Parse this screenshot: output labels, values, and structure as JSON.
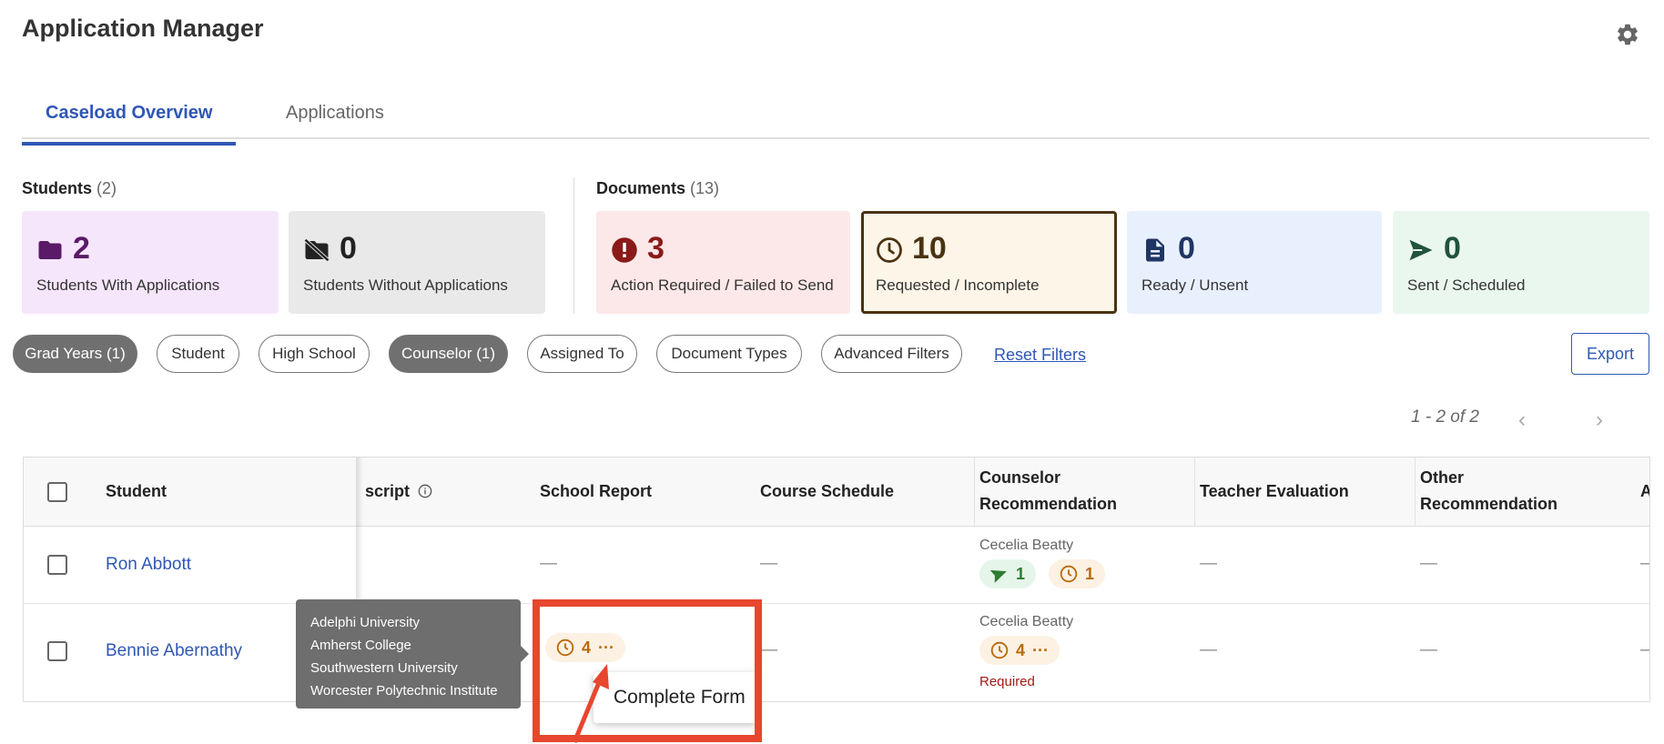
{
  "app": {
    "title": "Application Manager"
  },
  "tabs": [
    {
      "label": "Caseload Overview"
    },
    {
      "label": "Applications"
    }
  ],
  "students": {
    "label": "Students",
    "count": "(2)"
  },
  "documents": {
    "label": "Documents",
    "count": "(13)"
  },
  "cards": [
    {
      "value": "2",
      "label": "Students With Applications",
      "icon": "folder-icon",
      "bg": "#f6e6fb",
      "color": "#5a1a68"
    },
    {
      "value": "0",
      "label": "Students Without Applications",
      "icon": "folder-off-icon",
      "bg": "#e9e9e9",
      "color": "#222222"
    },
    {
      "value": "3",
      "label": "Action Required / Failed to Send",
      "icon": "alert-icon",
      "bg": "#fce8e8",
      "color": "#8a1a1a"
    },
    {
      "value": "10",
      "label": "Requested / Incomplete",
      "icon": "clock-icon",
      "bg": "#fdf5e8",
      "color": "#4a3312"
    },
    {
      "value": "0",
      "label": "Ready / Unsent",
      "icon": "document-icon",
      "bg": "#e9f0fd",
      "color": "#1f3564"
    },
    {
      "value": "0",
      "label": "Sent / Scheduled",
      "icon": "send-icon",
      "bg": "#eaf7ef",
      "color": "#21533b"
    }
  ],
  "filters": [
    {
      "label": "Grad Years (1)",
      "active": true
    },
    {
      "label": "Student",
      "active": false
    },
    {
      "label": "High School",
      "active": false
    },
    {
      "label": "Counselor (1)",
      "active": true
    },
    {
      "label": "Assigned To",
      "active": false
    },
    {
      "label": "Document Types",
      "active": false
    },
    {
      "label": "Advanced Filters",
      "active": false
    }
  ],
  "reset_filters": "Reset Filters",
  "export": "Export",
  "pagination": {
    "text": "1 - 2 of 2",
    "prev": "‹",
    "next": "›"
  },
  "table": {
    "headers": {
      "student": "Student",
      "transcript": "script",
      "school_report": "School Report",
      "course_schedule": "Course Schedule",
      "counselor_rec_1": "Counselor",
      "counselor_rec_2": "Recommendation",
      "teacher_eval": "Teacher Evaluation",
      "other_rec_1": "Other",
      "other_rec_2": "Recommendation",
      "truncated": "A"
    },
    "rows": [
      {
        "student": "Ron Abbott",
        "school_report": "—",
        "course_schedule": "—",
        "counselor_name": "Cecelia Beatty",
        "sent_count": "1",
        "pending_count": "1",
        "teacher_eval": "—",
        "other_rec": "—",
        "last": "–"
      },
      {
        "student": "Bennie Abernathy",
        "school_report_count": "4",
        "course_schedule": "—",
        "counselor_name": "Cecelia Beatty",
        "pending_count": "4",
        "required": "Required",
        "teacher_eval": "—",
        "other_rec": "—",
        "last": "–"
      }
    ]
  },
  "tooltip": {
    "lines": [
      "Adelphi University",
      "Amherst College",
      "Southwestern University",
      "Worcester Polytechnic Institute"
    ]
  },
  "popover": {
    "item": "Complete Form"
  },
  "more_glyph": "···",
  "colors": {
    "accent": "#2f57b5",
    "highlight": "#e8462f"
  }
}
